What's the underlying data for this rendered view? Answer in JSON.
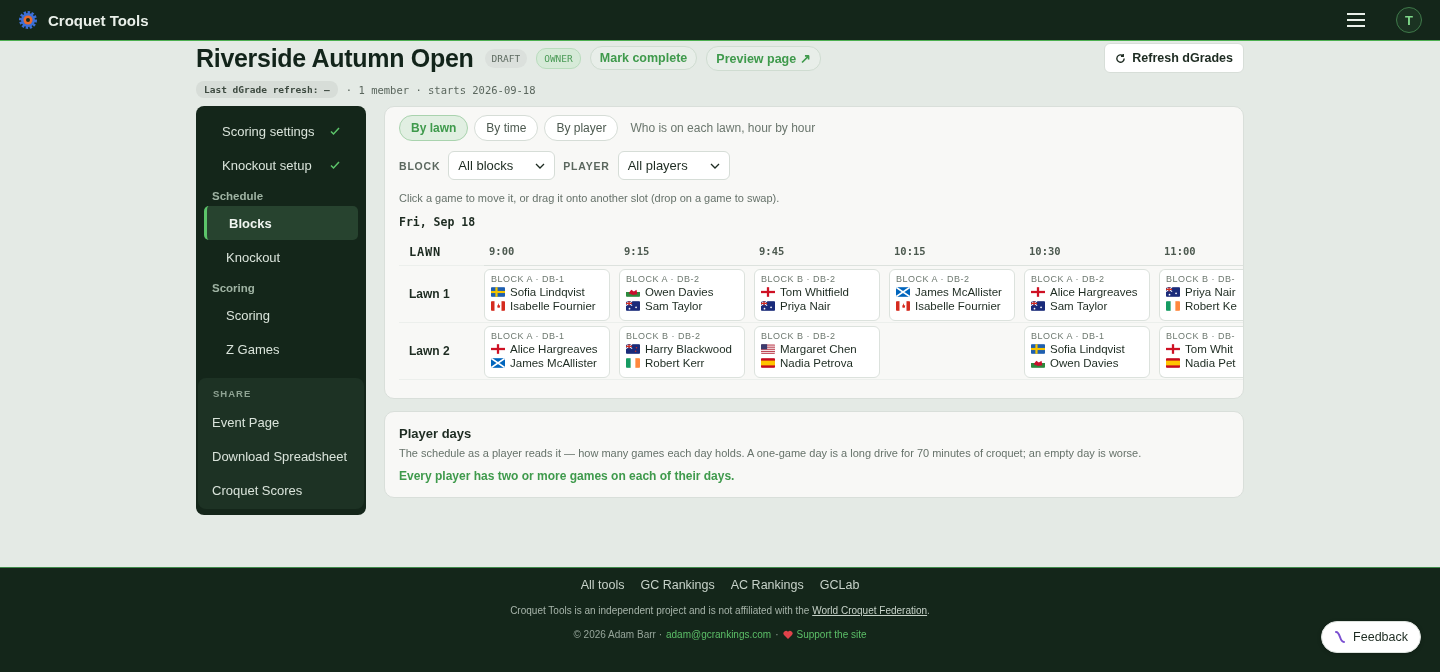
{
  "header": {
    "brand": "Croquet Tools",
    "avatar": "T"
  },
  "event": {
    "title": "Riverside Autumn Open",
    "badges": [
      {
        "label": "DRAFT",
        "kind": "draft"
      },
      {
        "label": "OWNER",
        "kind": "owner"
      }
    ],
    "actions": [
      "Mark complete",
      "Preview page ↗"
    ],
    "refresh_button": "Refresh dGrades",
    "refresh_pill": "Last dGrade refresh: –",
    "meta": "· 1 member · starts 2026-09-18"
  },
  "sidebar": {
    "items": [
      {
        "kind": "link",
        "label": "Scoring settings",
        "done": true,
        "selected": false
      },
      {
        "kind": "link",
        "label": "Knockout setup",
        "done": true,
        "selected": false
      },
      {
        "kind": "heading",
        "label": "Schedule"
      },
      {
        "kind": "sublink",
        "label": "Blocks",
        "done": false,
        "selected": true
      },
      {
        "kind": "sublink",
        "label": "Knockout",
        "done": false,
        "selected": false
      },
      {
        "kind": "heading",
        "label": "Scoring"
      },
      {
        "kind": "sublink",
        "label": "Scoring",
        "done": false,
        "selected": false
      },
      {
        "kind": "sublink",
        "label": "Z Games",
        "done": false,
        "selected": false
      }
    ],
    "share": {
      "heading": "SHARE",
      "items": [
        "Event Page",
        "Download Spreadsheet",
        "Croquet Scores"
      ]
    }
  },
  "schedule": {
    "views": [
      {
        "label": "By lawn",
        "selected": true
      },
      {
        "label": "By time",
        "selected": false
      },
      {
        "label": "By player",
        "selected": false
      }
    ],
    "view_hint": "Who is on each lawn, hour by hour",
    "filters": [
      {
        "label": "BLOCK",
        "value": "All blocks"
      },
      {
        "label": "PLAYER",
        "value": "All players"
      }
    ],
    "instructions": "Click a game to move it, or drag it onto another slot (drop on a game to swap).",
    "day": "Fri, Sep 18",
    "columns": [
      "LAWN",
      "9:00",
      "9:15",
      "9:45",
      "10:15",
      "10:30",
      "11:00"
    ],
    "rows": [
      {
        "lawn": "Lawn 1",
        "games": [
          {
            "kind": "game",
            "block": "BLOCK A · DB-1",
            "players": [
              {
                "name": "Sofia Lindqvist",
                "kind": "sweden"
              },
              {
                "name": "Isabelle Fournier",
                "kind": "canada"
              }
            ]
          },
          {
            "kind": "game",
            "block": "BLOCK A · DB-2",
            "players": [
              {
                "name": "Owen Davies",
                "kind": "wales"
              },
              {
                "name": "Sam Taylor",
                "kind": "australia"
              }
            ]
          },
          {
            "kind": "game",
            "block": "BLOCK B · DB-2",
            "players": [
              {
                "name": "Tom Whitfield",
                "kind": "england"
              },
              {
                "name": "Priya Nair",
                "kind": "australia"
              }
            ]
          },
          {
            "kind": "game",
            "block": "BLOCK A · DB-2",
            "players": [
              {
                "name": "James McAllister",
                "kind": "scotland"
              },
              {
                "name": "Isabelle Fournier",
                "kind": "canada"
              }
            ]
          },
          {
            "kind": "game",
            "block": "BLOCK A · DB-2",
            "players": [
              {
                "name": "Alice Hargreaves",
                "kind": "england"
              },
              {
                "name": "Sam Taylor",
                "kind": "australia"
              }
            ]
          },
          {
            "kind": "game",
            "block": "BLOCK B · DB-",
            "players": [
              {
                "name": "Priya Nair",
                "kind": "australia"
              },
              {
                "name": "Robert Ke",
                "kind": "ireland"
              }
            ]
          }
        ]
      },
      {
        "lawn": "Lawn 2",
        "games": [
          {
            "kind": "game",
            "block": "BLOCK A · DB-1",
            "players": [
              {
                "name": "Alice Hargreaves",
                "kind": "england"
              },
              {
                "name": "James McAllister",
                "kind": "scotland"
              }
            ]
          },
          {
            "kind": "game",
            "block": "BLOCK B · DB-2",
            "players": [
              {
                "name": "Harry Blackwood",
                "kind": "newzealand"
              },
              {
                "name": "Robert Kerr",
                "kind": "ireland"
              }
            ]
          },
          {
            "kind": "game",
            "block": "BLOCK B · DB-2",
            "players": [
              {
                "name": "Margaret Chen",
                "kind": "usa"
              },
              {
                "name": "Nadia Petrova",
                "kind": "spain"
              }
            ]
          },
          {
            "kind": "empty"
          },
          {
            "kind": "game",
            "block": "BLOCK A · DB-1",
            "players": [
              {
                "name": "Sofia Lindqvist",
                "kind": "sweden"
              },
              {
                "name": "Owen Davies",
                "kind": "wales"
              }
            ]
          },
          {
            "kind": "game",
            "block": "BLOCK B · DB-",
            "players": [
              {
                "name": "Tom Whit",
                "kind": "england"
              },
              {
                "name": "Nadia Pet",
                "kind": "spain"
              }
            ]
          }
        ]
      }
    ]
  },
  "player_days": {
    "title": "Player days",
    "description": "The schedule as a player reads it — how many games each day holds. A one-game day is a long drive for 70 minutes of croquet; an empty day is worse.",
    "status": "Every player has two or more games on each of their days."
  },
  "footer": {
    "links": [
      "All tools",
      "GC Rankings",
      "AC Rankings",
      "GCLab"
    ],
    "disclaimer": "Croquet Tools is an independent project and is not affiliated with the",
    "disclaimer_link": "World Croquet Federation",
    "disclaimer_end": ".",
    "copyright": "© 2026 Adam Barr ·",
    "email": "adam@gcrankings.com",
    "separator": "·",
    "support": "Support the site"
  },
  "feedback": "Feedback"
}
